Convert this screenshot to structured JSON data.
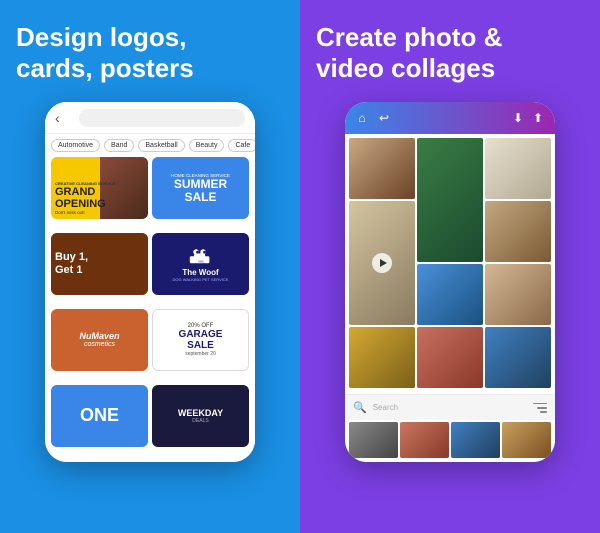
{
  "left": {
    "headline": "Design logos,\ncards, posters",
    "phone": {
      "categories": [
        "Automotive",
        "Band",
        "Basketball",
        "Beauty",
        "Cafe"
      ],
      "cards": [
        {
          "id": "grand-opening",
          "line1": "GRAND",
          "line2": "OPENING",
          "sub": "Don't miss out!",
          "tag": "CREATIVE CLEANING SERVICE"
        },
        {
          "id": "summer-sale",
          "top": "HOME CLEANING SERVICE",
          "main": "SUMMER\nSALE"
        },
        {
          "id": "buy-one",
          "line1": "Buy 1,",
          "line2": "Get 1"
        },
        {
          "id": "the-woof",
          "title": "The Woof",
          "sub": "DOG WALKING PET SERVICE"
        },
        {
          "id": "numaven",
          "title": "NuMaven",
          "sub": "cosmetics"
        },
        {
          "id": "garage-sale",
          "pct": "20% OFF",
          "main": "GARAGE\nSALE",
          "sub": "september 20"
        },
        {
          "id": "one",
          "text": "ONE"
        },
        {
          "id": "weekday-deals",
          "main": "WEEKDAY",
          "sub": "DEALS"
        }
      ]
    }
  },
  "right": {
    "headline": "Create photo &\nvideo collages",
    "phone": {
      "search_placeholder": "Search",
      "icons": {
        "home": "⌂",
        "undo": "↩",
        "download": "⬇",
        "share": "⬆"
      }
    }
  }
}
